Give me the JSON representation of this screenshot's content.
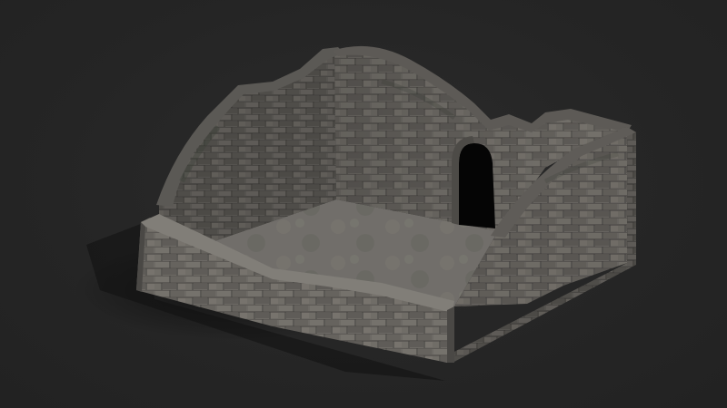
{
  "scene": {
    "subject_icon": "stone-ruin-icon",
    "background_color": "#262626",
    "stone_color": "#6f6c67",
    "floor_color": "#7a7873",
    "doorway_color": "#050505"
  }
}
